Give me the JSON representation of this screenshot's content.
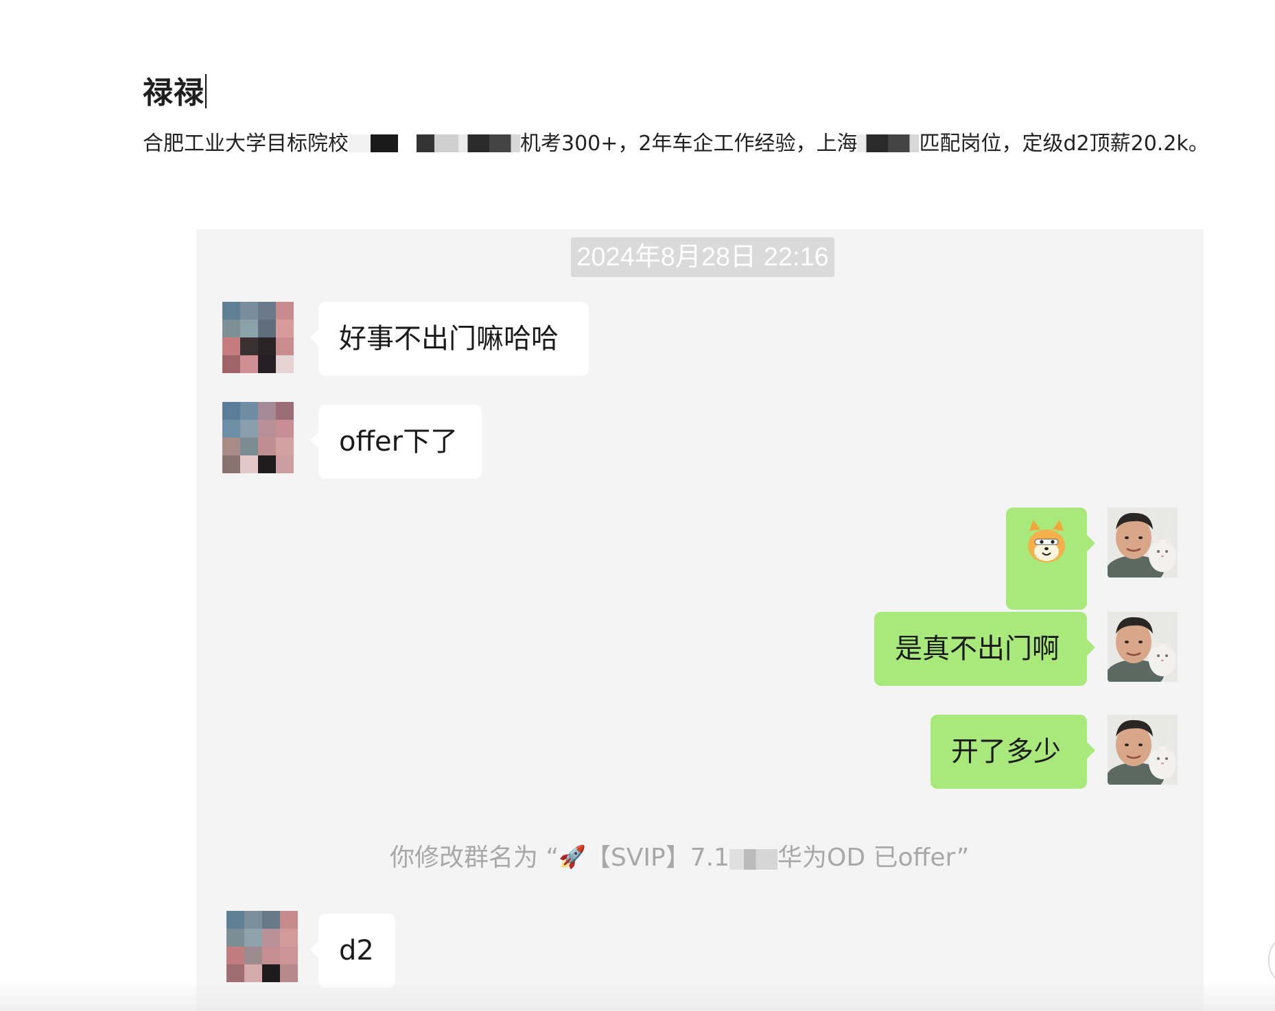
{
  "document": {
    "title": "禄禄",
    "desc_part1": "合肥工业大学目标院校",
    "desc_part2": "机考300+，2年车企工作经验，上海",
    "desc_part3": "匹配岗位，定级d2顶薪20.2k。"
  },
  "chat": {
    "timestamp": "2024年8月28日 22:16",
    "messages": [
      {
        "direction": "incoming",
        "text": "好事不出门嘛哈哈"
      },
      {
        "direction": "incoming",
        "text": "offer下了"
      },
      {
        "direction": "outgoing",
        "type": "sticker",
        "sticker": "shiba-dog-face"
      },
      {
        "direction": "outgoing",
        "text": "是真不出门啊"
      },
      {
        "direction": "outgoing",
        "text": "开了多少"
      },
      {
        "direction": "incoming",
        "text": "d2"
      }
    ],
    "system_note": {
      "prefix": "你修改群名为 “",
      "icon": "rocket-icon",
      "text": "【SVIP】7.1",
      "suffix": "华为OD 已offer”"
    }
  },
  "colors": {
    "chat_background": "#f4f4f4",
    "incoming_bubble": "#ffffff",
    "outgoing_bubble": "#a9e87a",
    "timestamp_background": "#dadada",
    "system_text": "#a8a8a8"
  }
}
